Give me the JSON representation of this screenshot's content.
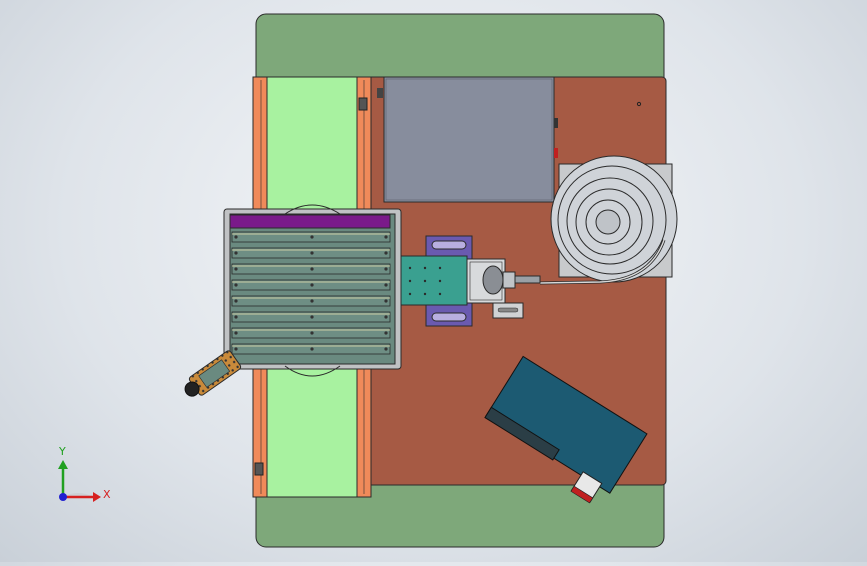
{
  "viewport": {
    "view_orientation": "top",
    "background_gradient": [
      "#f4f6f8",
      "#c9d0d8"
    ]
  },
  "triad": {
    "x_label": "X",
    "y_label": "Y",
    "x_color": "#d62020",
    "y_color": "#20a020",
    "z_color": "#2020d0"
  },
  "model": {
    "base_plate_color": "#7ea87a",
    "table_color": "#a65a44",
    "conveyor_belt_color": "#a8f2a0",
    "conveyor_frame_color": "#f08a5a",
    "control_box_color": "#878d9d",
    "tray_color": "#6a8a80",
    "tray_top_slat_color": "#7a1a8a",
    "slide_block_color": "#3aa090",
    "bracket_color": "#6a5ab0",
    "motor_box_color": "#1c5a72",
    "coil_fill": "#cfd3d8",
    "slat_count": 8
  }
}
